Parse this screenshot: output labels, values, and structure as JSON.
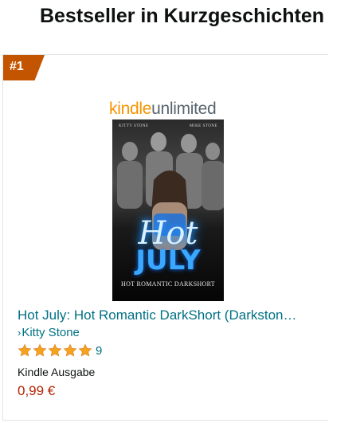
{
  "header": {
    "title": "Bestseller in Kurzgeschichten"
  },
  "product": {
    "rank": "#1",
    "badge": {
      "kindle": "kindle",
      "unlimited": "unlimited"
    },
    "cover": {
      "author_left": "KITTY STONE",
      "author_right": "MIKE STONE",
      "title_line1": "Hot",
      "title_line2": "JULY",
      "subtitle": "HOT ROMANTIC DARKSHORT"
    },
    "title": "Hot July: Hot Romantic DarkShort (Darkston…",
    "author_chevron": "›",
    "author": "Kitty Stone",
    "rating_stars": 5,
    "rating_count": "9",
    "format": "Kindle Ausgabe",
    "price": "0,99 €"
  },
  "colors": {
    "link": "#007185",
    "price": "#b12704",
    "star": "#f4a41c",
    "rank_badge": "#c45500"
  }
}
